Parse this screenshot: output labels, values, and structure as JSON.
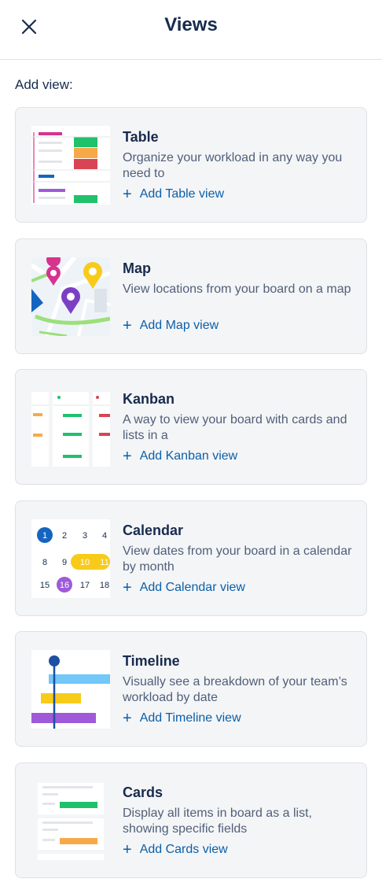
{
  "header": {
    "title": "Views"
  },
  "section_label": "Add view:",
  "views": [
    {
      "title": "Table",
      "description": "Organize your workload in any way you need to",
      "add_label": "Add Table view"
    },
    {
      "title": "Map",
      "description": "View locations from your board on a map",
      "add_label": "Add Map view"
    },
    {
      "title": "Kanban",
      "description": "A way to view your board with cards and lists in a",
      "add_label": "Add Kanban view"
    },
    {
      "title": "Calendar",
      "description": "View dates from your board in a calendar by month",
      "add_label": "Add Calendar view"
    },
    {
      "title": "Timeline",
      "description": "Visually see a breakdown of your team’s workload by date",
      "add_label": "Add Timeline view"
    },
    {
      "title": "Cards",
      "description": "Display all items in board as a list, showing specific fields",
      "add_label": "Add Cards view"
    }
  ],
  "calendar_thumb": {
    "rows": [
      [
        "1",
        "2",
        "3",
        "4"
      ],
      [
        "8",
        "9",
        "10",
        "11"
      ],
      [
        "15",
        "16",
        "17",
        "18"
      ]
    ]
  },
  "icons": {
    "close": "close-icon",
    "plus": "plus-icon"
  },
  "colors": {
    "accent": "#0b5fa8",
    "card_bg": "#f4f5f7",
    "green": "#1fc16b",
    "orange": "#f7a94a",
    "red": "#d94454",
    "magenta": "#d8338f",
    "purple": "#9e5ad9",
    "yellow": "#f8cb1a",
    "blue": "#1565c0",
    "light_blue": "#72c8f8"
  }
}
